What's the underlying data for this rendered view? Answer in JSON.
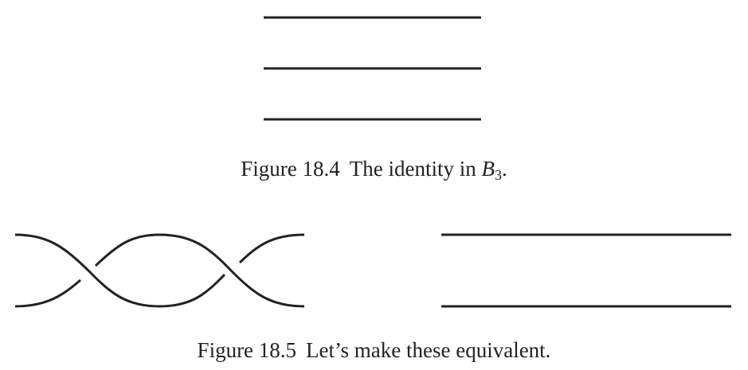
{
  "figure_18_4": {
    "label": "Figure 18.4",
    "text": "The identity in",
    "math_var": "B",
    "math_sub": "3",
    "end_punct": "."
  },
  "figure_18_5": {
    "label": "Figure 18.5",
    "text": "Let’s make these equivalent."
  },
  "colors": {
    "stroke": "#222222",
    "background": "#ffffff"
  }
}
